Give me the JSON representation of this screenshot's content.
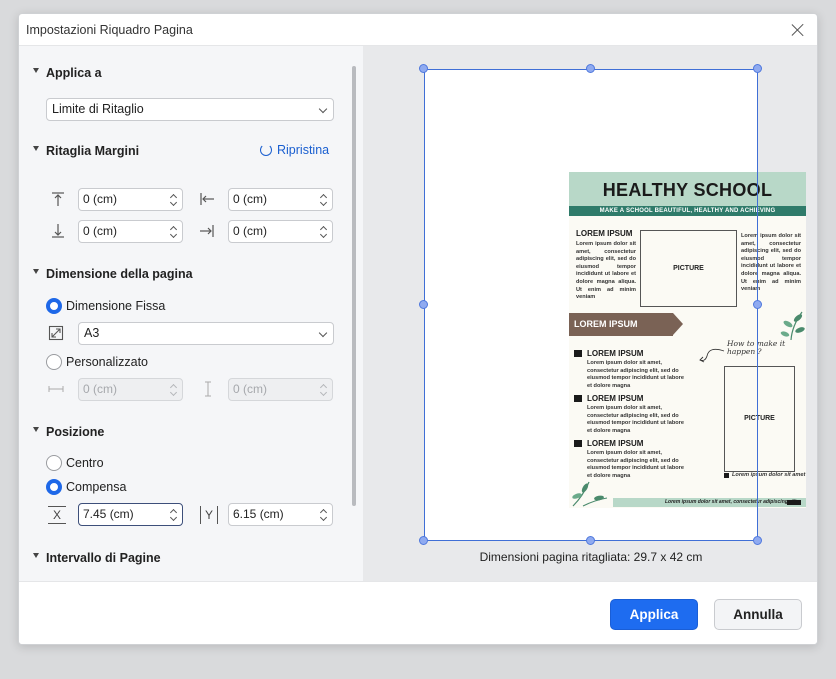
{
  "dialog": {
    "title": "Impostazioni Riquadro Pagina",
    "close_icon": "close-icon"
  },
  "apply_to": {
    "section_label": "Applica a",
    "selected": "Limite di Ritaglio"
  },
  "margins": {
    "section_label": "Ritaglia Margini",
    "reset_label": "Ripristina",
    "top": "0 (cm)",
    "left": "0 (cm)",
    "bottom": "0 (cm)",
    "right": "0 (cm)"
  },
  "page_size": {
    "section_label": "Dimensione della pagina",
    "fixed_label": "Dimensione Fissa",
    "fixed_selected": true,
    "size_selected": "A3",
    "custom_label": "Personalizzato",
    "custom_width": "0 (cm)",
    "custom_height": "0 (cm)"
  },
  "position": {
    "section_label": "Posizione",
    "center_label": "Centro",
    "offset_label": "Compensa",
    "offset_selected": true,
    "x_label": "X",
    "y_label": "Y",
    "x_value": "7.45 (cm)",
    "y_value": "6.15 (cm)"
  },
  "page_range": {
    "section_label": "Intervallo di Pagine"
  },
  "preview": {
    "crop_info": "Dimensioni pagina ritagliata: 29.7 x 42 cm",
    "poster": {
      "title": "HEALTHY SCHOOL",
      "subtitle": "MAKE A SCHOOL BEAUTIFUL, HEALTHY AND ACHIEVING",
      "lorem_heading": "LOREM IPSUM",
      "picture_label": "PICTURE",
      "body_text_left": "Lorem ipsum dolor sit amet, consectetur adipiscing elit, sed do eiusmod tempor incididunt ut labore et dolore magna aliqua. Ut enim ad minim veniam",
      "body_text_right": "Lorem ipsum dolor sit amet, consectetur adipiscing elit, sed do eiusmod tempor incididunt ut labore et dolore magna aliqua. Ut enim ad minim veniam",
      "band_label": "LOREM IPSUM",
      "handwritten": "How to make it happen ?",
      "list": [
        {
          "heading": "LOREM IPSUM",
          "text": "Lorem ipsum dolor sit amet, consectetur adipiscing elit, sed do eiusmod tempor incididunt ut labore et dolore magna"
        },
        {
          "heading": "LOREM IPSUM",
          "text": "Lorem ipsum dolor sit amet, consectetur adipiscing elit, sed do eiusmod tempor incididunt ut labore et dolore magna"
        },
        {
          "heading": "LOREM IPSUM",
          "text": "Lorem ipsum dolor sit amet, consectetur adipiscing elit, sed do eiusmod tempor incididunt ut labore et dolore magna"
        }
      ],
      "picture_caption": "Lorem ipsum dolor sit amet",
      "footer_text": "Lorem ipsum dolor sit amet, consectetur adipiscing elit"
    }
  },
  "footer": {
    "apply_label": "Applica",
    "cancel_label": "Annulla"
  },
  "colors": {
    "primary": "#1e6cf0",
    "link": "#1a5fd0",
    "poster_green": "#b8d8c8",
    "poster_dark_green": "#2f7b6a",
    "poster_brown": "#7a6255"
  }
}
